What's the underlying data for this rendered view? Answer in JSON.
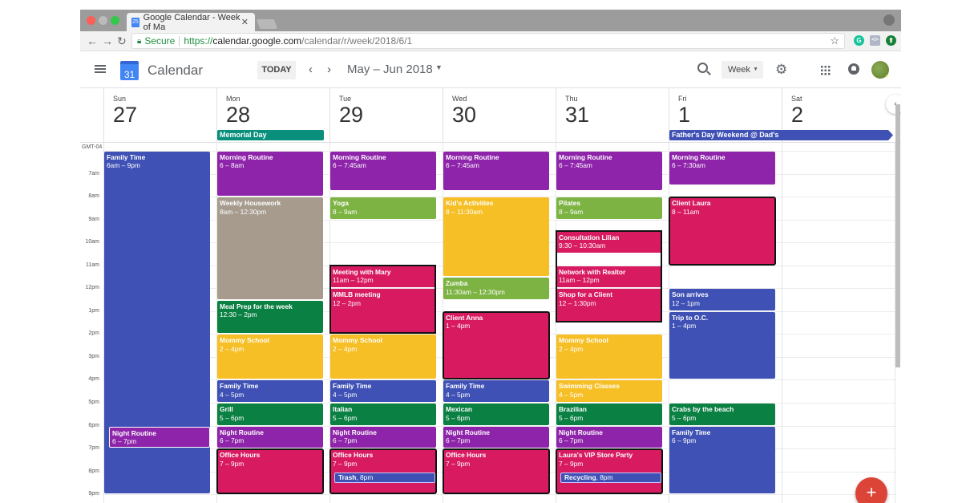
{
  "browser": {
    "tab_title": "Google Calendar - Week of Ma",
    "tab_favicon": "25",
    "url_secure_label": "Secure",
    "url_protocol": "https://",
    "url_host": "calendar.google.com",
    "url_path": "/calendar/r/week/2018/6/1"
  },
  "header": {
    "logo_day": "31",
    "app_name": "Calendar",
    "today_label": "TODAY",
    "prev_label": "‹",
    "next_label": "›",
    "date_range": "May – Jun 2018",
    "view_label": "Week",
    "dropdown_glyph": "▼"
  },
  "timezone": "GMT-04",
  "hours": [
    "7am",
    "8am",
    "9am",
    "10am",
    "11am",
    "12pm",
    "1pm",
    "2pm",
    "3pm",
    "4pm",
    "5pm",
    "6pm",
    "7pm",
    "8pm",
    "9pm"
  ],
  "days": [
    {
      "name": "Sun",
      "date": "27"
    },
    {
      "name": "Mon",
      "date": "28"
    },
    {
      "name": "Tue",
      "date": "29"
    },
    {
      "name": "Wed",
      "date": "30"
    },
    {
      "name": "Thu",
      "date": "31"
    },
    {
      "name": "Fri",
      "date": "1"
    },
    {
      "name": "Sat",
      "date": "2"
    }
  ],
  "all_day_events": [
    {
      "title": "Memorial Day",
      "color": "#0b8f7d"
    },
    {
      "title": "Father's Day Weekend @ Dad's",
      "color": "#3f51b5"
    }
  ],
  "colors": {
    "blue": "#3f51b5",
    "purple": "#8e24aa",
    "taupe": "#a79b8e",
    "green": "#0b8043",
    "lightgreen": "#7cb342",
    "yellow": "#f6bf26",
    "pink": "#d81b60"
  },
  "events": [
    {
      "day": 0,
      "start": 6,
      "end": 21,
      "title": "Family Time",
      "time": "6am – 9pm",
      "color": "blue"
    },
    {
      "day": 0,
      "start": 18,
      "end": 19,
      "title": "Night Routine",
      "time": "6 – 7pm",
      "color": "purple",
      "inner": true,
      "indent": 1
    },
    {
      "day": 1,
      "start": 6,
      "end": 8,
      "title": "Morning Routine",
      "time": "6 – 8am",
      "color": "purple"
    },
    {
      "day": 1,
      "start": 8,
      "end": 12.5,
      "title": "Weekly Housework",
      "time": "8am – 12:30pm",
      "color": "taupe"
    },
    {
      "day": 1,
      "start": 12.5,
      "end": 14,
      "title": "Meal Prep for the week",
      "time": "12:30 – 2pm",
      "color": "green"
    },
    {
      "day": 1,
      "start": 14,
      "end": 16,
      "title": "Mommy School",
      "time": "2 – 4pm",
      "color": "yellow"
    },
    {
      "day": 1,
      "start": 16,
      "end": 17,
      "title": "Family Time",
      "time": "4 – 5pm",
      "color": "blue"
    },
    {
      "day": 1,
      "start": 17,
      "end": 18,
      "title": "Grill",
      "time": "5 – 6pm",
      "color": "green"
    },
    {
      "day": 1,
      "start": 18,
      "end": 19,
      "title": "Night Routine",
      "time": "6 – 7pm",
      "color": "purple"
    },
    {
      "day": 1,
      "start": 19,
      "end": 21,
      "title": "Office Hours",
      "time": "7 – 9pm",
      "color": "pink",
      "highlight": true
    },
    {
      "day": 2,
      "start": 6,
      "end": 7.75,
      "title": "Morning Routine",
      "time": "6 – 7:45am",
      "color": "purple"
    },
    {
      "day": 2,
      "start": 8,
      "end": 9,
      "title": "Yoga",
      "time": "8 – 9am",
      "color": "lightgreen"
    },
    {
      "day": 2,
      "start": 11,
      "end": 12,
      "title": "Meeting with Mary",
      "time": "11am – 12pm",
      "color": "pink",
      "highlight_group": "tue-am"
    },
    {
      "day": 2,
      "start": 12,
      "end": 14,
      "title": "MMLB meeting",
      "time": "12 – 2pm",
      "color": "pink",
      "highlight_group": "tue-am"
    },
    {
      "day": 2,
      "start": 14,
      "end": 16,
      "title": "Mommy School",
      "time": "2 – 4pm",
      "color": "yellow"
    },
    {
      "day": 2,
      "start": 16,
      "end": 17,
      "title": "Family Time",
      "time": "4 – 5pm",
      "color": "blue"
    },
    {
      "day": 2,
      "start": 17,
      "end": 18,
      "title": "Italian",
      "time": "5 – 6pm",
      "color": "green"
    },
    {
      "day": 2,
      "start": 18,
      "end": 19,
      "title": "Night Routine",
      "time": "6 – 7pm",
      "color": "purple"
    },
    {
      "day": 2,
      "start": 19,
      "end": 21,
      "title": "Office Hours",
      "time": "7 – 9pm",
      "color": "pink",
      "highlight": true
    },
    {
      "day": 3,
      "start": 6,
      "end": 7.75,
      "title": "Morning Routine",
      "time": "6 – 7:45am",
      "color": "purple"
    },
    {
      "day": 3,
      "start": 8,
      "end": 11.5,
      "title": "Kid's Activities",
      "time": "8 – 11:30am",
      "color": "yellow"
    },
    {
      "day": 3,
      "start": 11.5,
      "end": 12.5,
      "title": "Zumba",
      "time": "11:30am – 12:30pm",
      "color": "lightgreen"
    },
    {
      "day": 3,
      "start": 13,
      "end": 16,
      "title": "Client Anna",
      "time": "1 – 4pm",
      "color": "pink",
      "highlight": true
    },
    {
      "day": 3,
      "start": 16,
      "end": 17,
      "title": "Family Time",
      "time": "4 – 5pm",
      "color": "blue"
    },
    {
      "day": 3,
      "start": 17,
      "end": 18,
      "title": "Mexican",
      "time": "5 – 6pm",
      "color": "green"
    },
    {
      "day": 3,
      "start": 18,
      "end": 19,
      "title": "Night Routine",
      "time": "6 – 7pm",
      "color": "purple"
    },
    {
      "day": 3,
      "start": 19,
      "end": 21,
      "title": "Office Hours",
      "time": "7 – 9pm",
      "color": "pink",
      "highlight": true
    },
    {
      "day": 4,
      "start": 6,
      "end": 7.75,
      "title": "Morning Routine",
      "time": "6 – 7:45am",
      "color": "purple"
    },
    {
      "day": 4,
      "start": 8,
      "end": 9,
      "title": "Pilates",
      "time": "8 – 9am",
      "color": "lightgreen"
    },
    {
      "day": 4,
      "start": 9.5,
      "end": 10.5,
      "title": "Consultation Lilian",
      "time": "9:30 – 10:30am",
      "color": "pink",
      "highlight_group": "thu-am"
    },
    {
      "day": 4,
      "start": 11,
      "end": 12,
      "title": "Network with Realtor",
      "time": "11am – 12pm",
      "color": "pink",
      "highlight_group": "thu-am"
    },
    {
      "day": 4,
      "start": 12,
      "end": 13.5,
      "title": "Shop for a Client",
      "time": "12 – 1:30pm",
      "color": "pink",
      "highlight_group": "thu-am"
    },
    {
      "day": 4,
      "start": 14,
      "end": 16,
      "title": "Mommy School",
      "time": "2 – 4pm",
      "color": "yellow"
    },
    {
      "day": 4,
      "start": 16,
      "end": 17,
      "title": "Swimming Classes",
      "time": "4 – 5pm",
      "color": "yellow"
    },
    {
      "day": 4,
      "start": 17,
      "end": 18,
      "title": "Brazilian",
      "time": "5 – 6pm",
      "color": "green"
    },
    {
      "day": 4,
      "start": 18,
      "end": 19,
      "title": "Night Routine",
      "time": "6 – 7pm",
      "color": "purple"
    },
    {
      "day": 4,
      "start": 19,
      "end": 21,
      "title": "Laura's VIP Store Party",
      "time": "7 – 9pm",
      "color": "pink",
      "highlight": true
    },
    {
      "day": 5,
      "start": 6,
      "end": 7.5,
      "title": "Morning Routine",
      "time": "6 – 7:30am",
      "color": "purple"
    },
    {
      "day": 5,
      "start": 8,
      "end": 11,
      "title": "Client Laura",
      "time": "8 – 11am",
      "color": "pink",
      "highlight": true
    },
    {
      "day": 5,
      "start": 12,
      "end": 13,
      "title": "Son arrives",
      "time": "12 – 1pm",
      "color": "blue"
    },
    {
      "day": 5,
      "start": 13,
      "end": 16,
      "title": "Trip to O.C.",
      "time": "1 – 4pm",
      "color": "blue"
    },
    {
      "day": 5,
      "start": 17,
      "end": 18,
      "title": "Crabs by the beach",
      "time": "5 – 6pm",
      "color": "green"
    },
    {
      "day": 5,
      "start": 18,
      "end": 21,
      "title": "Family Time",
      "time": "6 – 9pm",
      "color": "blue"
    }
  ],
  "chips": [
    {
      "day": 2,
      "at": 20,
      "title": "Trash",
      "time": ", 8pm",
      "color": "blue"
    },
    {
      "day": 4,
      "at": 20,
      "title": "Recycling",
      "time": ", 8pm",
      "color": "blue"
    }
  ],
  "fab_label": "+",
  "collapse_label": "‹"
}
